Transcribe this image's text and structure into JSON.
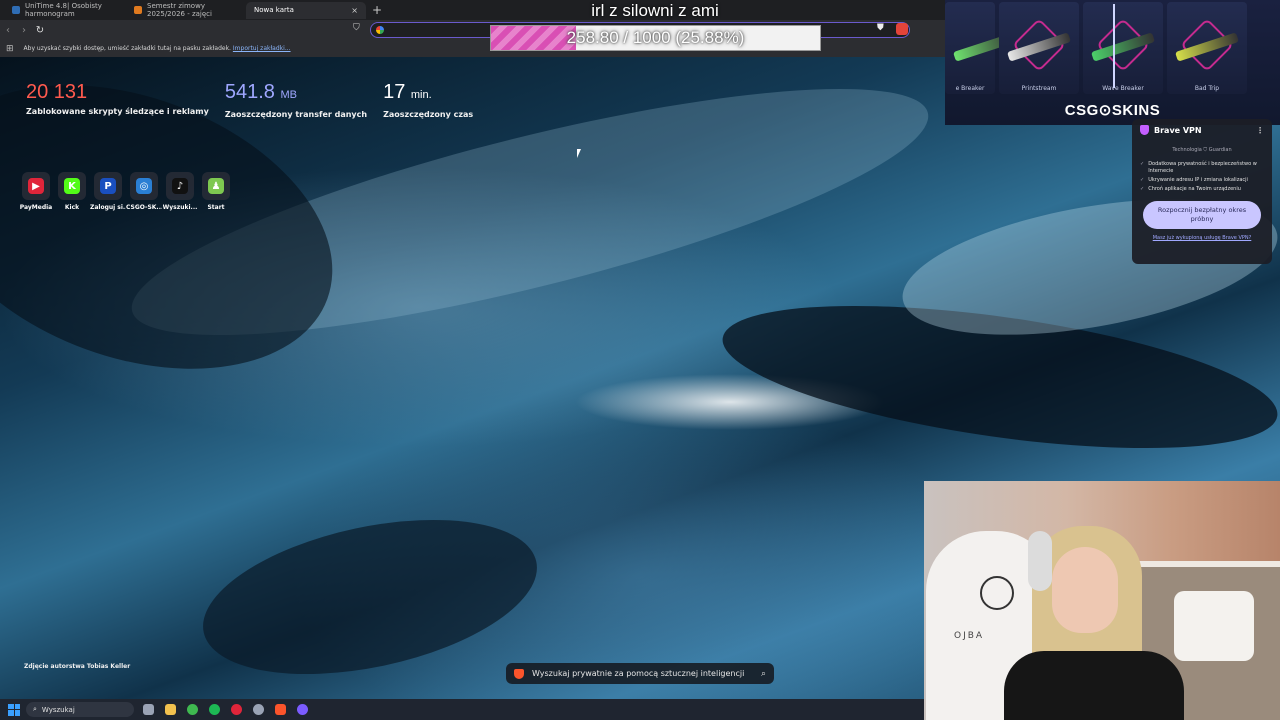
{
  "stream": {
    "title": "irl z silowni z ami",
    "goal_text": "258.80 / 1000 (25.88%)",
    "goal_fraction": 0.2588
  },
  "browser": {
    "tabs": [
      {
        "label": "UniTime 4.8| Osobisty harmonogram",
        "favicon_color": "#2f6db5"
      },
      {
        "label": "Semestr zimowy 2025/2026 - zajęci",
        "favicon_color": "#e07a1f"
      },
      {
        "label": "Nowa karta",
        "favicon_color": ""
      }
    ],
    "new_tab_label": "+",
    "close_label": "×",
    "bookmarks_bar_text": "Aby uzyskać szybki dostęp, umieść zakładki tutaj na pasku zakładek.",
    "bookmarks_import_link": "Importuj zakładki..."
  },
  "stats": [
    {
      "value": "20 131",
      "unit": "",
      "label": "Zablokowane skrypty śledzące i reklamy",
      "color": "#ff5a4e"
    },
    {
      "value": "541.8",
      "unit": "MB",
      "label": "Zaoszczędzony transfer danych",
      "color": "#9fa7ff"
    },
    {
      "value": "17",
      "unit": "min.",
      "label": "Zaoszczędzony czas",
      "color": "#ffffff"
    }
  ],
  "shortcuts": [
    {
      "label": "PayMedia",
      "glyph": "▶",
      "color": "#e0253a"
    },
    {
      "label": "Kick",
      "glyph": "K",
      "color": "#53fc18"
    },
    {
      "label": "Zaloguj si...",
      "glyph": "P",
      "color": "#1a4fbf"
    },
    {
      "label": "CSGO-SK...",
      "glyph": "◎",
      "color": "#2a7fd4"
    },
    {
      "label": "Wyszuki...",
      "glyph": "♪",
      "color": "#111111"
    },
    {
      "label": "Start",
      "glyph": "♟",
      "color": "#7ec850"
    }
  ],
  "photo_credit": "Zdjęcie autorstwa Tobias Keller",
  "ai_search_placeholder": "Wyszukaj prywatnie za pomocą sztucznej inteligencji",
  "skins_banner": {
    "items": [
      {
        "name": "e Breaker",
        "gun_color": "#6fe26f"
      },
      {
        "name": "Printstream",
        "gun_color": "#e8e8e8"
      },
      {
        "name": "Wave Breaker",
        "gun_color": "#4ccf6a"
      },
      {
        "name": "Bad Trip",
        "gun_color": "#d7e04a"
      }
    ],
    "logo": "CSG⊙SKINS"
  },
  "vpn": {
    "title": "Brave VPN",
    "subtitle": "Technologia ⛉ Guardian",
    "features": [
      "Dodatkowa prywatność i bezpieczeństwo w Internecie",
      "Ukrywanie adresu IP i zmiana lokalizacji",
      "Chroń aplikacje na Twoim urządzeniu"
    ],
    "cta": "Rozpocznij bezpłatny okres próbny",
    "link": "Masz już wykupioną usługę Brave VPN?"
  },
  "webcam": {
    "chair_text": "OJBA"
  },
  "taskbar": {
    "search_label": "Wyszukaj",
    "apps": [
      {
        "name": "task-view",
        "color": "#9aa3b5"
      },
      {
        "name": "file-explorer",
        "color": "#f2c14e"
      },
      {
        "name": "xbox",
        "color": "#3fb950"
      },
      {
        "name": "spotify",
        "color": "#1db954"
      },
      {
        "name": "opera",
        "color": "#e0253a"
      },
      {
        "name": "chrome",
        "color": "#9aa3b5"
      },
      {
        "name": "brave",
        "color": "#fb542b"
      },
      {
        "name": "discord",
        "color": "#7b5cff"
      }
    ]
  }
}
